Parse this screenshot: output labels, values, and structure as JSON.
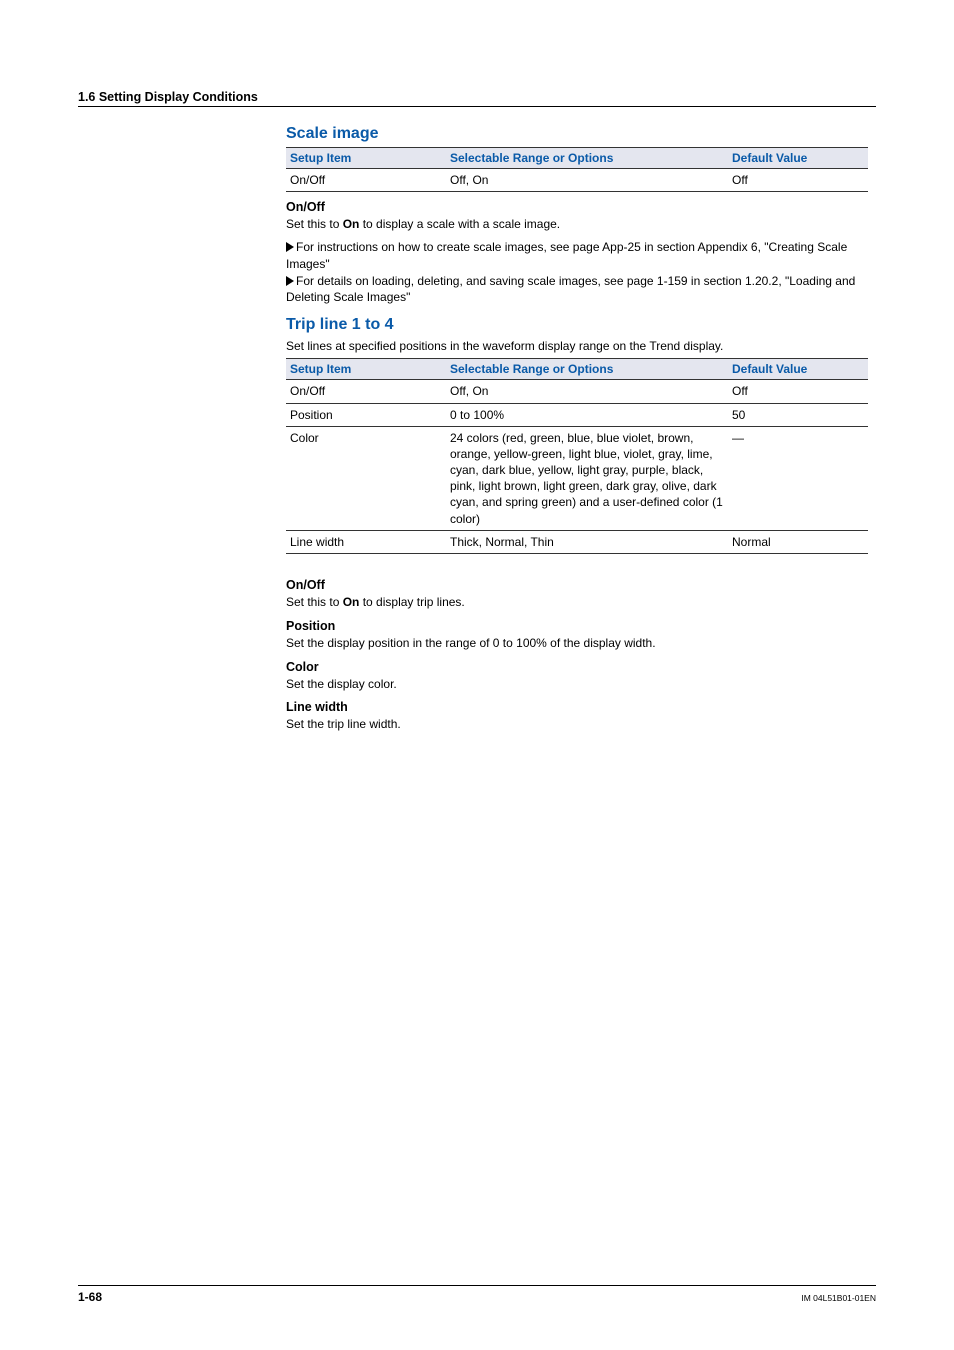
{
  "breadcrumb": "1.6  Setting Display Conditions",
  "table_headers": {
    "item": "Setup Item",
    "range": "Selectable Range or Options",
    "def": "Default Value"
  },
  "scale_image": {
    "title": "Scale image",
    "row": {
      "item": "On/Off",
      "range": "Off, On",
      "def": "Off"
    },
    "onoff": {
      "h": "On/Off",
      "p1_a": "Set this to ",
      "p1_b": "On",
      "p1_c": " to display a scale with a scale image.",
      "link1": "For instructions on how to create scale images, see page App-25 in section Appendix  6, \"Creating Scale Images\"",
      "link2": "For details on loading, deleting, and saving scale images, see page 1-159 in section 1.20.2, \"Loading and Deleting Scale Images\""
    }
  },
  "trip": {
    "title": "Trip line 1 to 4",
    "desc": "Set lines at specified positions in the waveform display range on the Trend display.",
    "rows": [
      {
        "item": "On/Off",
        "range": "Off, On",
        "def": "Off"
      },
      {
        "item": "Position",
        "range": "0 to 100%",
        "def": "50"
      },
      {
        "item": "Color",
        "range": "24 colors (red, green, blue, blue violet, brown, orange, yellow-green, light blue, violet, gray, lime, cyan, dark blue, yellow, light gray, purple, black, pink, light brown, light green, dark gray, olive, dark cyan, and spring green) and a user-defined color (1 color)",
        "def": "—"
      },
      {
        "item": "Line width",
        "range": "Thick, Normal, Thin",
        "def": "Normal"
      }
    ],
    "sections": {
      "onoff": {
        "h": "On/Off",
        "p_a": "Set this to ",
        "p_b": "On",
        "p_c": " to display trip lines."
      },
      "position": {
        "h": "Position",
        "p": "Set the display position in the range of 0 to 100% of the display width."
      },
      "color": {
        "h": "Color",
        "p": "Set the display color."
      },
      "width": {
        "h": "Line width",
        "p": "Set the trip line width."
      }
    }
  },
  "footer": {
    "page": "1-68",
    "doc": "IM 04L51B01-01EN"
  }
}
